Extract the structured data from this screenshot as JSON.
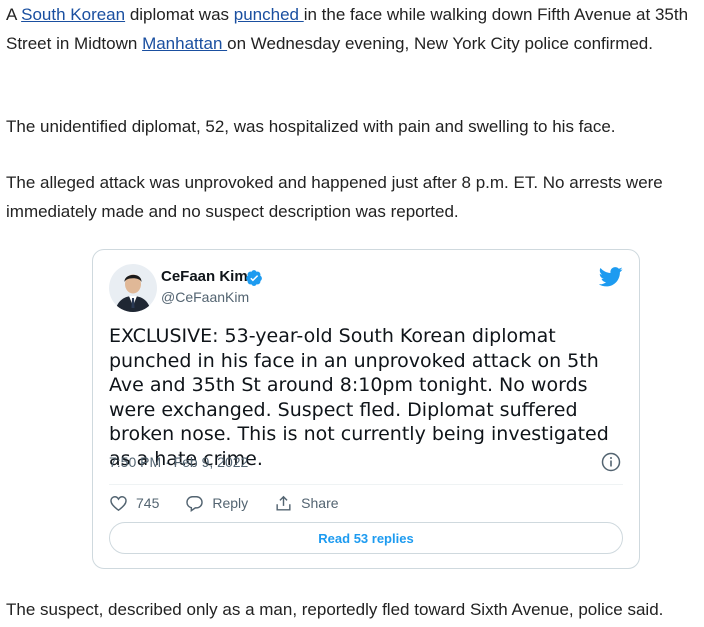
{
  "article": {
    "p1_pre": "A ",
    "p1_link1": "South Korean",
    "p1_mid1": " diplomat was ",
    "p1_link2": "punched ",
    "p1_mid2": "in the face while walking down Fifth Avenue at 35th Street in Midtown ",
    "p1_link3": "Manhattan ",
    "p1_post": "on Wednesday evening, New York City police confirmed.",
    "p2": "The unidentified diplomat, 52, was hospitalized with pain and swelling to his face.",
    "p3": "The alleged attack was unprovoked and happened just after 8 p.m. ET. No arrests were immediately made and no suspect description was reported.",
    "p4": "The suspect, described only as a man, reportedly fled toward Sixth Avenue, police said."
  },
  "tweet": {
    "author_name": "CeFaan Kim",
    "handle": "@CeFaanKim",
    "text": "EXCLUSIVE: 53-year-old South Korean diplomat punched in his face in an unprovoked attack on 5th Ave and 35th St around 8:10pm tonight. No words were exchanged. Suspect fled. Diplomat suffered broken nose. This is not currently being investigated as a hate crime.",
    "timestamp": "7:50 PM · Feb 9, 2022",
    "likes": "745",
    "reply_label": "Reply",
    "share_label": "Share",
    "read_replies": "Read 53 replies",
    "icons": [
      "verified-badge-icon",
      "twitter-bird-icon",
      "info-icon",
      "heart-icon",
      "reply-icon",
      "share-icon"
    ],
    "colors": {
      "accent": "#1d9bf0",
      "link": "#1a4fa0"
    }
  }
}
